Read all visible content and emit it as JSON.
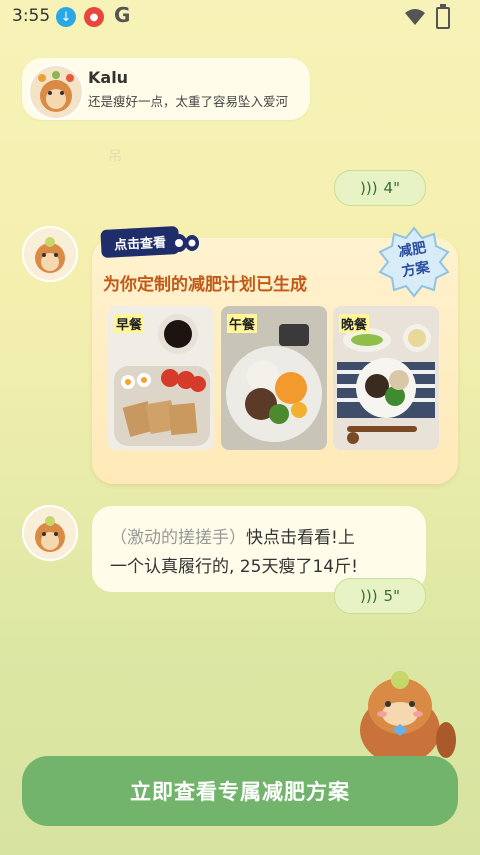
{
  "status_bar": {
    "time": "3:55",
    "google": "G"
  },
  "chat": {
    "name": "Kalu",
    "subtitle": "还是瘦好一点，太重了容易坠入爱河",
    "faded_text": "吊",
    "voice1": "4\"",
    "voice2": "5\""
  },
  "plan": {
    "tag": "点击查看",
    "title": "为你定制的减肥计划已生成",
    "badge_line1": "减肥",
    "badge_line2": "方案",
    "meals": [
      {
        "label": "早餐"
      },
      {
        "label": "午餐"
      },
      {
        "label": "晚餐"
      }
    ]
  },
  "message": {
    "muted": "（激动的搓搓手）",
    "line1_rest": "快点击看看!上",
    "line2": "一个认真履行的, 25天瘦了14斤!"
  },
  "cta": {
    "label": "立即查看专属减肥方案"
  },
  "colors": {
    "accent": "#73b46d",
    "title": "#c25a17",
    "tag": "#1f2d6b"
  }
}
